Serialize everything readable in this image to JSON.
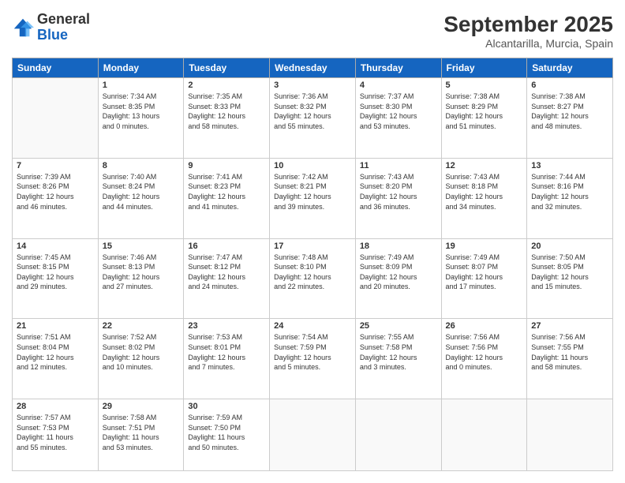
{
  "header": {
    "logo_general": "General",
    "logo_blue": "Blue",
    "month_title": "September 2025",
    "location": "Alcantarilla, Murcia, Spain"
  },
  "weekdays": [
    "Sunday",
    "Monday",
    "Tuesday",
    "Wednesday",
    "Thursday",
    "Friday",
    "Saturday"
  ],
  "days": [
    {
      "date": "",
      "info": ""
    },
    {
      "date": "1",
      "info": "Sunrise: 7:34 AM\nSunset: 8:35 PM\nDaylight: 13 hours\nand 0 minutes."
    },
    {
      "date": "2",
      "info": "Sunrise: 7:35 AM\nSunset: 8:33 PM\nDaylight: 12 hours\nand 58 minutes."
    },
    {
      "date": "3",
      "info": "Sunrise: 7:36 AM\nSunset: 8:32 PM\nDaylight: 12 hours\nand 55 minutes."
    },
    {
      "date": "4",
      "info": "Sunrise: 7:37 AM\nSunset: 8:30 PM\nDaylight: 12 hours\nand 53 minutes."
    },
    {
      "date": "5",
      "info": "Sunrise: 7:38 AM\nSunset: 8:29 PM\nDaylight: 12 hours\nand 51 minutes."
    },
    {
      "date": "6",
      "info": "Sunrise: 7:38 AM\nSunset: 8:27 PM\nDaylight: 12 hours\nand 48 minutes."
    },
    {
      "date": "7",
      "info": "Sunrise: 7:39 AM\nSunset: 8:26 PM\nDaylight: 12 hours\nand 46 minutes."
    },
    {
      "date": "8",
      "info": "Sunrise: 7:40 AM\nSunset: 8:24 PM\nDaylight: 12 hours\nand 44 minutes."
    },
    {
      "date": "9",
      "info": "Sunrise: 7:41 AM\nSunset: 8:23 PM\nDaylight: 12 hours\nand 41 minutes."
    },
    {
      "date": "10",
      "info": "Sunrise: 7:42 AM\nSunset: 8:21 PM\nDaylight: 12 hours\nand 39 minutes."
    },
    {
      "date": "11",
      "info": "Sunrise: 7:43 AM\nSunset: 8:20 PM\nDaylight: 12 hours\nand 36 minutes."
    },
    {
      "date": "12",
      "info": "Sunrise: 7:43 AM\nSunset: 8:18 PM\nDaylight: 12 hours\nand 34 minutes."
    },
    {
      "date": "13",
      "info": "Sunrise: 7:44 AM\nSunset: 8:16 PM\nDaylight: 12 hours\nand 32 minutes."
    },
    {
      "date": "14",
      "info": "Sunrise: 7:45 AM\nSunset: 8:15 PM\nDaylight: 12 hours\nand 29 minutes."
    },
    {
      "date": "15",
      "info": "Sunrise: 7:46 AM\nSunset: 8:13 PM\nDaylight: 12 hours\nand 27 minutes."
    },
    {
      "date": "16",
      "info": "Sunrise: 7:47 AM\nSunset: 8:12 PM\nDaylight: 12 hours\nand 24 minutes."
    },
    {
      "date": "17",
      "info": "Sunrise: 7:48 AM\nSunset: 8:10 PM\nDaylight: 12 hours\nand 22 minutes."
    },
    {
      "date": "18",
      "info": "Sunrise: 7:49 AM\nSunset: 8:09 PM\nDaylight: 12 hours\nand 20 minutes."
    },
    {
      "date": "19",
      "info": "Sunrise: 7:49 AM\nSunset: 8:07 PM\nDaylight: 12 hours\nand 17 minutes."
    },
    {
      "date": "20",
      "info": "Sunrise: 7:50 AM\nSunset: 8:05 PM\nDaylight: 12 hours\nand 15 minutes."
    },
    {
      "date": "21",
      "info": "Sunrise: 7:51 AM\nSunset: 8:04 PM\nDaylight: 12 hours\nand 12 minutes."
    },
    {
      "date": "22",
      "info": "Sunrise: 7:52 AM\nSunset: 8:02 PM\nDaylight: 12 hours\nand 10 minutes."
    },
    {
      "date": "23",
      "info": "Sunrise: 7:53 AM\nSunset: 8:01 PM\nDaylight: 12 hours\nand 7 minutes."
    },
    {
      "date": "24",
      "info": "Sunrise: 7:54 AM\nSunset: 7:59 PM\nDaylight: 12 hours\nand 5 minutes."
    },
    {
      "date": "25",
      "info": "Sunrise: 7:55 AM\nSunset: 7:58 PM\nDaylight: 12 hours\nand 3 minutes."
    },
    {
      "date": "26",
      "info": "Sunrise: 7:56 AM\nSunset: 7:56 PM\nDaylight: 12 hours\nand 0 minutes."
    },
    {
      "date": "27",
      "info": "Sunrise: 7:56 AM\nSunset: 7:55 PM\nDaylight: 11 hours\nand 58 minutes."
    },
    {
      "date": "28",
      "info": "Sunrise: 7:57 AM\nSunset: 7:53 PM\nDaylight: 11 hours\nand 55 minutes."
    },
    {
      "date": "29",
      "info": "Sunrise: 7:58 AM\nSunset: 7:51 PM\nDaylight: 11 hours\nand 53 minutes."
    },
    {
      "date": "30",
      "info": "Sunrise: 7:59 AM\nSunset: 7:50 PM\nDaylight: 11 hours\nand 50 minutes."
    },
    {
      "date": "",
      "info": ""
    },
    {
      "date": "",
      "info": ""
    },
    {
      "date": "",
      "info": ""
    },
    {
      "date": "",
      "info": ""
    },
    {
      "date": "",
      "info": ""
    }
  ]
}
